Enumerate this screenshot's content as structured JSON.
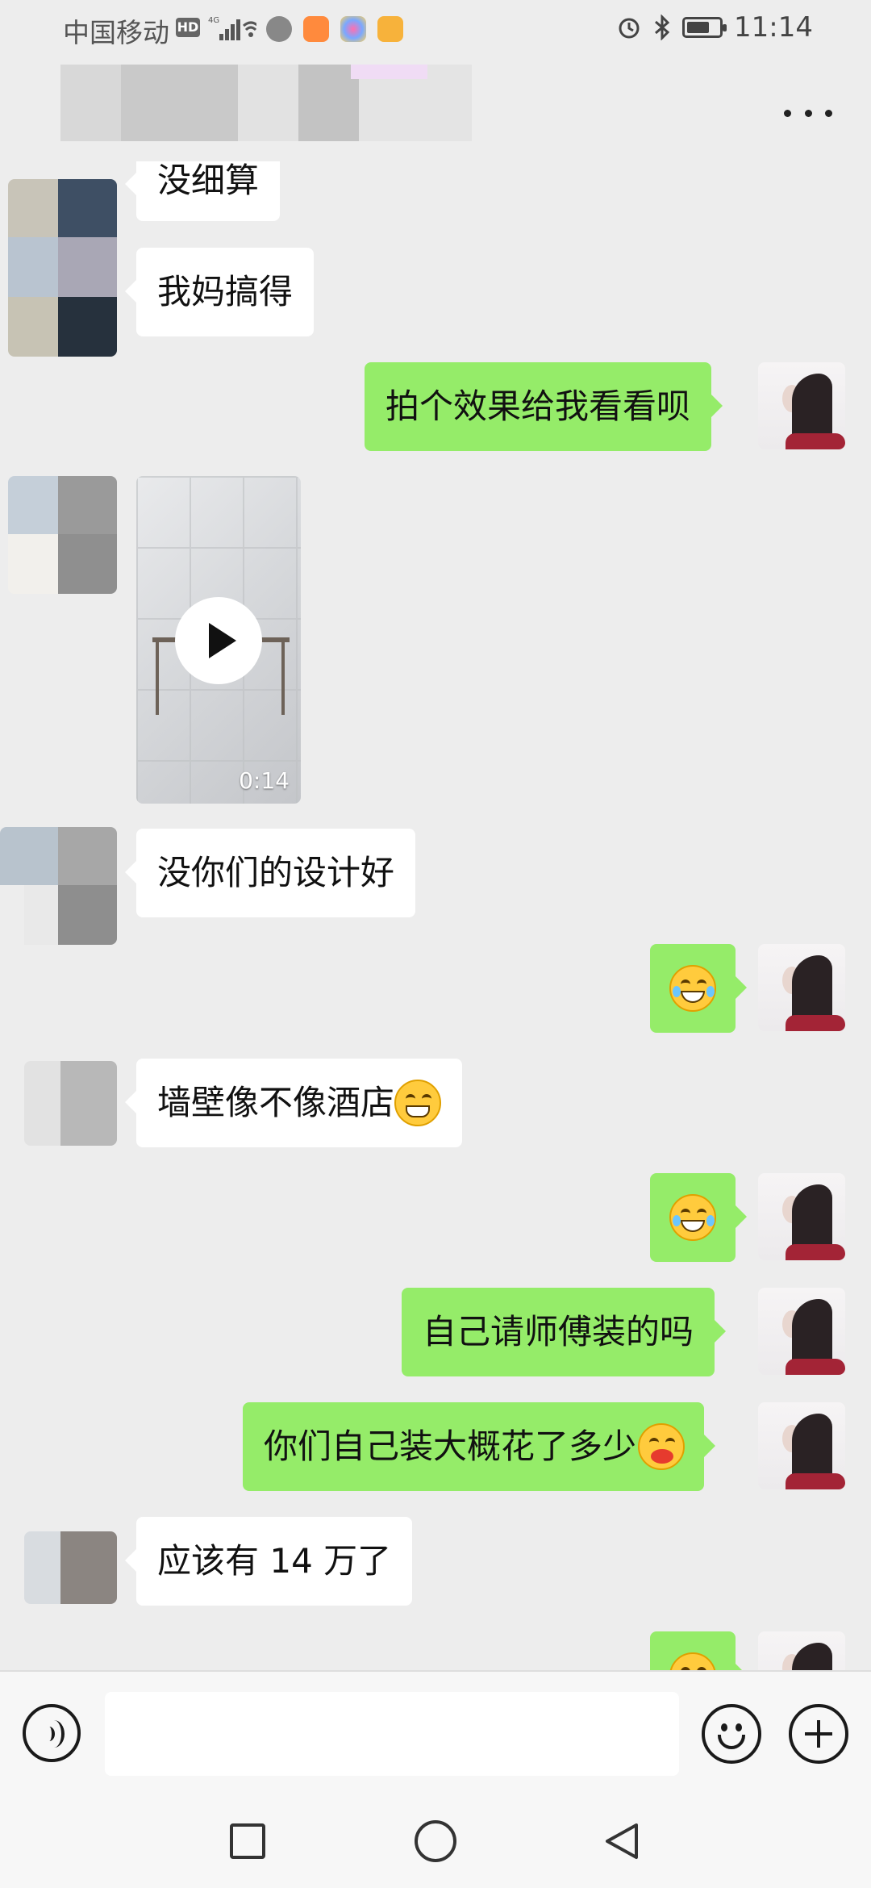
{
  "status_bar": {
    "carrier": "中国移动",
    "hd_badge": "HD",
    "time": "11:14",
    "battery_level": 0.7
  },
  "header": {
    "menu_icon": "more-dots-icon"
  },
  "messages": [
    {
      "side": "in",
      "text": "没细算"
    },
    {
      "side": "in",
      "text": "我妈搞得"
    },
    {
      "side": "out",
      "text": "拍个效果给我看看呗"
    },
    {
      "side": "in",
      "type": "video",
      "duration": "0:14"
    },
    {
      "side": "in",
      "text": "没你们的设计好"
    },
    {
      "side": "out",
      "type": "emoji",
      "emoji": "tears-of-joy"
    },
    {
      "side": "in",
      "text": "墙壁像不像酒店",
      "emoji": "grinning-face"
    },
    {
      "side": "out",
      "type": "emoji",
      "emoji": "tears-of-joy"
    },
    {
      "side": "out",
      "text": "自己请师傅装的吗"
    },
    {
      "side": "out",
      "text": "你们自己装大概花了多少",
      "emoji": "hand-over-mouth-face"
    },
    {
      "side": "in",
      "text": "应该有 14 万了"
    },
    {
      "side": "out",
      "type": "emoji",
      "emoji": "tears-of-joy"
    }
  ],
  "input_bar": {
    "voice_icon": "voice-input-icon",
    "emoji_icon": "emoji-icon",
    "plus_icon": "plus-icon",
    "text_value": ""
  },
  "system_nav": {
    "recent_icon": "recent-apps-icon",
    "home_icon": "home-icon",
    "back_icon": "back-icon"
  }
}
